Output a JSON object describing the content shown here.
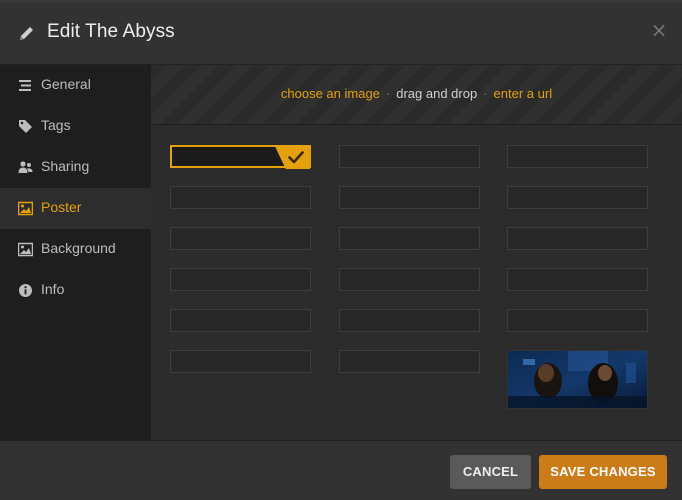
{
  "dialog": {
    "title": "Edit The Abyss",
    "close_glyph": "×"
  },
  "sidebar": {
    "items": [
      {
        "label": "General",
        "icon": "list-icon",
        "active": false
      },
      {
        "label": "Tags",
        "icon": "tag-icon",
        "active": false
      },
      {
        "label": "Sharing",
        "icon": "users-icon",
        "active": false
      },
      {
        "label": "Poster",
        "icon": "image-icon",
        "active": true
      },
      {
        "label": "Background",
        "icon": "image-icon",
        "active": false
      },
      {
        "label": "Info",
        "icon": "info-icon",
        "active": false
      }
    ]
  },
  "upload": {
    "choose": "choose an image",
    "sep": "·",
    "drag": "drag and drop",
    "url": "enter a url"
  },
  "poster_grid": {
    "columns": 3,
    "rows": 6,
    "selected_index": 0,
    "image_index": 17
  },
  "footer": {
    "cancel_label": "CANCEL",
    "save_label": "SAVE CHANGES"
  },
  "colors": {
    "accent": "#e5a00d",
    "save_button": "#cc7b19",
    "cancel_button": "#5a5a5a"
  }
}
